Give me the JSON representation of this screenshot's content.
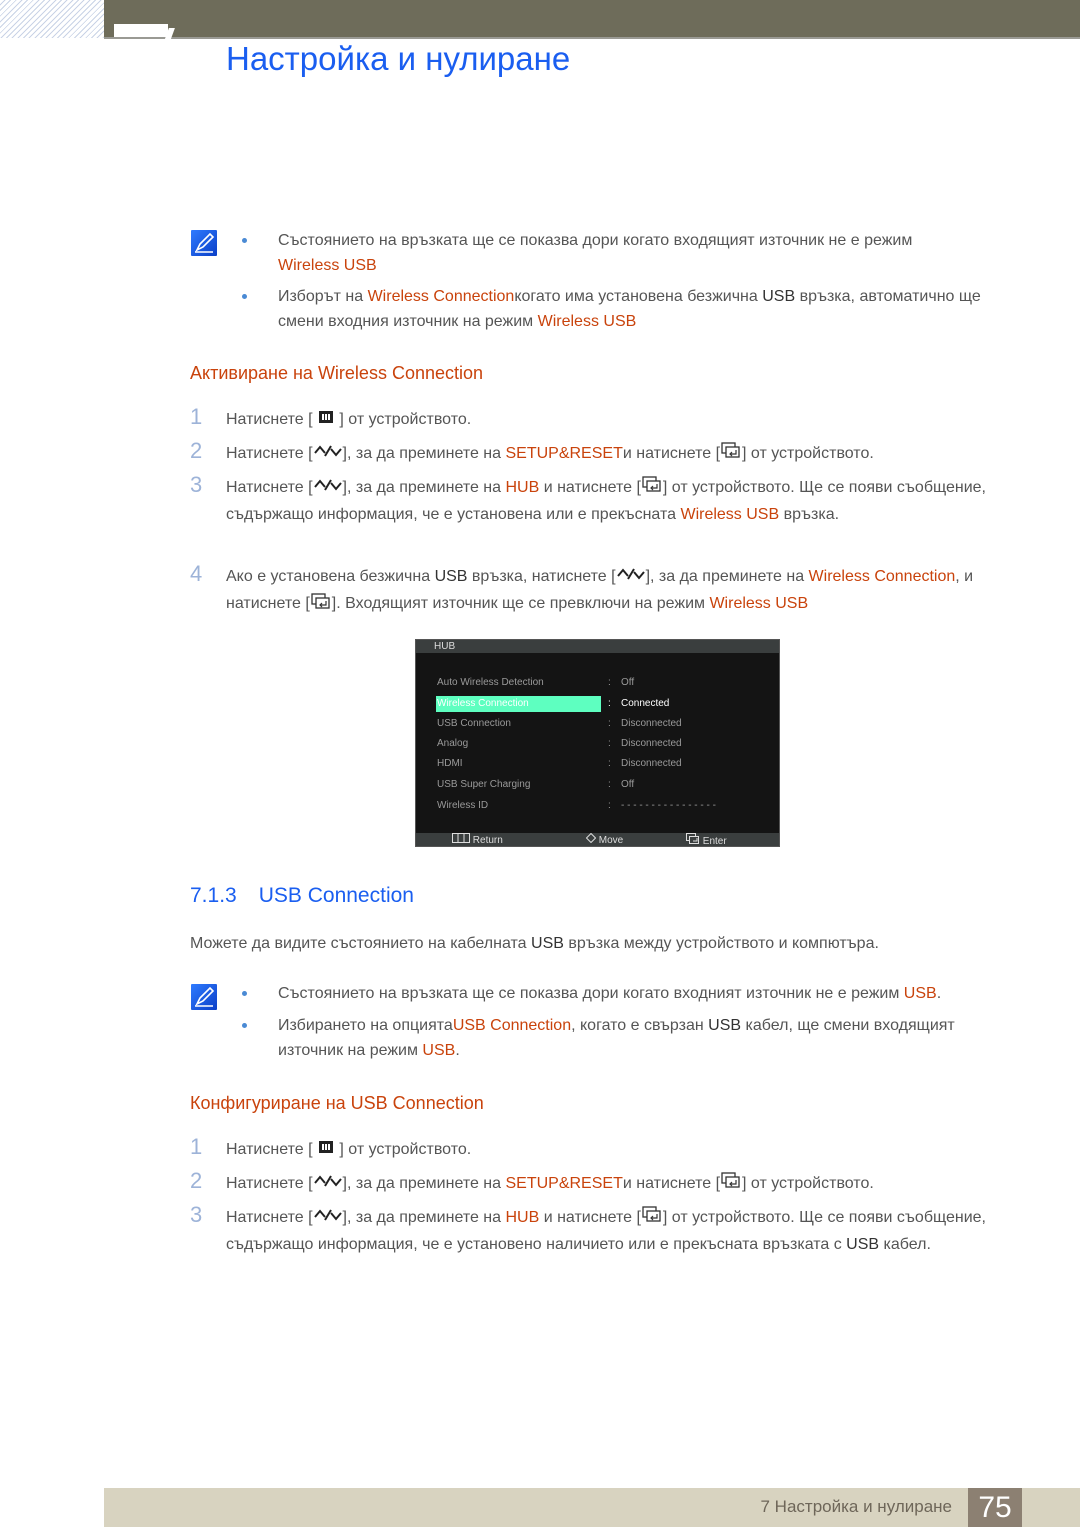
{
  "header": {
    "chapter_number": "7",
    "title": "Настройка и нулиране"
  },
  "colors": {
    "title_blue": "#1a5ef0",
    "highlight_orange": "#c9430c",
    "topbar": "#6e6c5a",
    "osd_selected": "#5effc0",
    "footer_bg": "#d8d3c0",
    "page_box": "#8c8072"
  },
  "notes1": [
    {
      "parts": [
        {
          "t": "Състоянието на връзката ще се показва дори когато входящият източник не е режим "
        },
        {
          "t": "Wireless USB",
          "hl": true
        }
      ]
    },
    {
      "parts": [
        {
          "t": "Изборът на "
        },
        {
          "t": "Wireless Connection",
          "hl": true
        },
        {
          "t": "когато има установена безжична "
        },
        {
          "t": "USB",
          "dk": true
        },
        {
          "t": " връзка, автоматично ще смени входния източник на режим "
        },
        {
          "t": "Wireless USB",
          "hl": true
        }
      ]
    }
  ],
  "subsection1": {
    "prefix": "Активиране на ",
    "name": "Wireless Connection"
  },
  "steps1": [
    {
      "num": "1",
      "text": "Натиснете [ ",
      "menu_key": true,
      "rest": " ] от устройството."
    },
    {
      "num": "2",
      "a": "Натиснете [",
      "b": "], за да преминете на ",
      "target": "SETUP&RESET",
      "c": "и натиснете [",
      "d": "] от устройството."
    },
    {
      "num": "3",
      "a": "Натиснете [",
      "b": "], за да преминете на ",
      "target": "HUB",
      "c": " и натиснете [",
      "d": "] от устройството. Ще се появи съобщение, съдържащо информация, че е установена или е прекъсната ",
      "e": "Wireless USB",
      "f": " връзка."
    },
    {
      "num": "4",
      "a": "Ако е установена безжична ",
      "usb": "USB",
      "b": " връзка, натиснете [",
      "c": "], за да преминете на ",
      "target": "Wireless Connection",
      "d": ", и натиснете [",
      "e": "]. Входящият източник ще се превключи на режим ",
      "f": "Wireless USB"
    }
  ],
  "osd": {
    "title": "HUB",
    "rows": [
      {
        "label": "Auto Wireless Detection",
        "value": "Off"
      },
      {
        "label": "Wireless Connection",
        "value": "Connected",
        "selected": true
      },
      {
        "label": "USB Connection",
        "value": "Disconnected"
      },
      {
        "label": "Analog",
        "value": "Disconnected"
      },
      {
        "label": "HDMI",
        "value": "Disconnected"
      },
      {
        "label": "USB Super Charging",
        "value": "Off"
      },
      {
        "label": "Wireless ID",
        "value": "- - - - - - - - - - - - - - - -"
      }
    ],
    "footer": {
      "return": "Return",
      "move": "Move",
      "enter": "Enter"
    }
  },
  "section": {
    "number": "7.1.3",
    "title": "USB Connection",
    "intro_a": "Можете да видите състоянието на кабелната ",
    "intro_usb": "USB",
    "intro_b": " връзка между устройството и компютъра."
  },
  "notes2": [
    {
      "parts": [
        {
          "t": "Състоянието на връзката ще се показва дори когато входният източник не е режим "
        },
        {
          "t": "USB",
          "hl": true
        },
        {
          "t": "."
        }
      ]
    },
    {
      "parts": [
        {
          "t": "Избирането на опцията"
        },
        {
          "t": "USB Connection",
          "hl": true
        },
        {
          "t": ", когато е свързан "
        },
        {
          "t": "USB",
          "dk": true
        },
        {
          "t": " кабел, ще смени входящият източник на режим "
        },
        {
          "t": "USB",
          "hl": true
        },
        {
          "t": "."
        }
      ]
    }
  ],
  "subsection2": {
    "prefix": "Конфигуриране на ",
    "name": "USB Connection"
  },
  "steps2": [
    {
      "num": "1",
      "text": "Натиснете [ ",
      "rest": " ] от устройството."
    },
    {
      "num": "2",
      "a": "Натиснете [",
      "b": "], за да преминете на ",
      "target": "SETUP&RESET",
      "c": "и натиснете [",
      "d": "] от устройството."
    },
    {
      "num": "3",
      "a": "Натиснете [",
      "b": "], за да преминете на ",
      "target": "HUB",
      "c": " и натиснете [",
      "d": "] от устройството. Ще се появи съобщение, съдържащо информация, че е установено наличието или е прекъсната връзката с ",
      "usb": "USB",
      "e": " кабел."
    }
  ],
  "footer": {
    "text": "7 Настройка и нулиране",
    "page": "75"
  }
}
